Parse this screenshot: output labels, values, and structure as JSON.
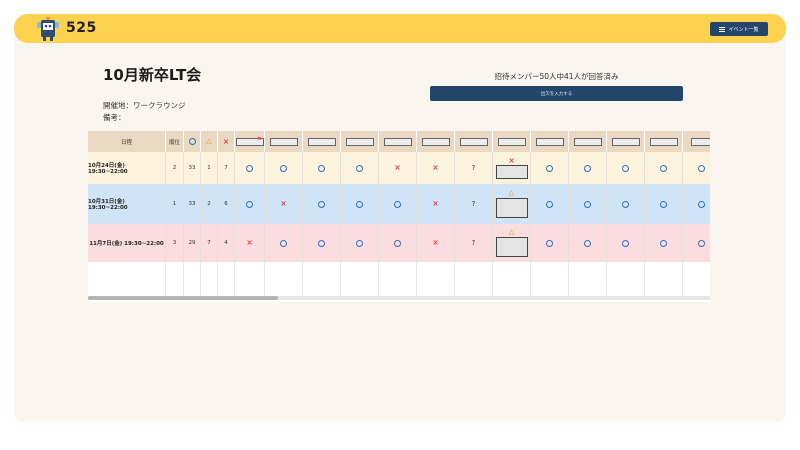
{
  "header": {
    "brand": "525",
    "event_list_label": "イベント一覧",
    "accent_color": "#fcd24f",
    "button_color": "#25466b"
  },
  "event": {
    "title": "10月新卒LT会",
    "venue": "開催地：ワークラウンジ",
    "note": "備考：",
    "response_summary": "招待メンバー50人中41人が回答済み",
    "attend_button": "出欠を入力する"
  },
  "table": {
    "headers": {
      "date": "日程",
      "rank": "順位",
      "circle_icon": "circle-icon",
      "triangle_icon": "triangle-icon",
      "cross_icon": "cross-icon"
    },
    "rows": [
      {
        "date": "10月24日(金) 19:30~22:00",
        "rank": "2",
        "circle": "33",
        "triangle": "1",
        "cross": "7",
        "marks": [
          "o",
          "o",
          "o",
          "o",
          "x",
          "x",
          "?",
          "x-box",
          "o",
          "o",
          "o",
          "o",
          "o"
        ]
      },
      {
        "date": "10月31日(金) 19:30~22:00",
        "rank": "1",
        "circle": "33",
        "triangle": "2",
        "cross": "6",
        "marks": [
          "o",
          "x",
          "o",
          "o",
          "o",
          "x",
          "?",
          "t-box",
          "o",
          "o",
          "o",
          "o",
          "o"
        ]
      },
      {
        "date": "11月7日(金) 19:30~22:00",
        "rank": "3",
        "circle": "29",
        "triangle": "7",
        "cross": "4",
        "marks": [
          "x",
          "o",
          "o",
          "o",
          "o",
          "x",
          "?",
          "t-box",
          "o",
          "o",
          "o",
          "o",
          "o"
        ]
      }
    ],
    "symbols": {
      "o": "○",
      "x": "×",
      "t": "△",
      "q": "?"
    }
  }
}
